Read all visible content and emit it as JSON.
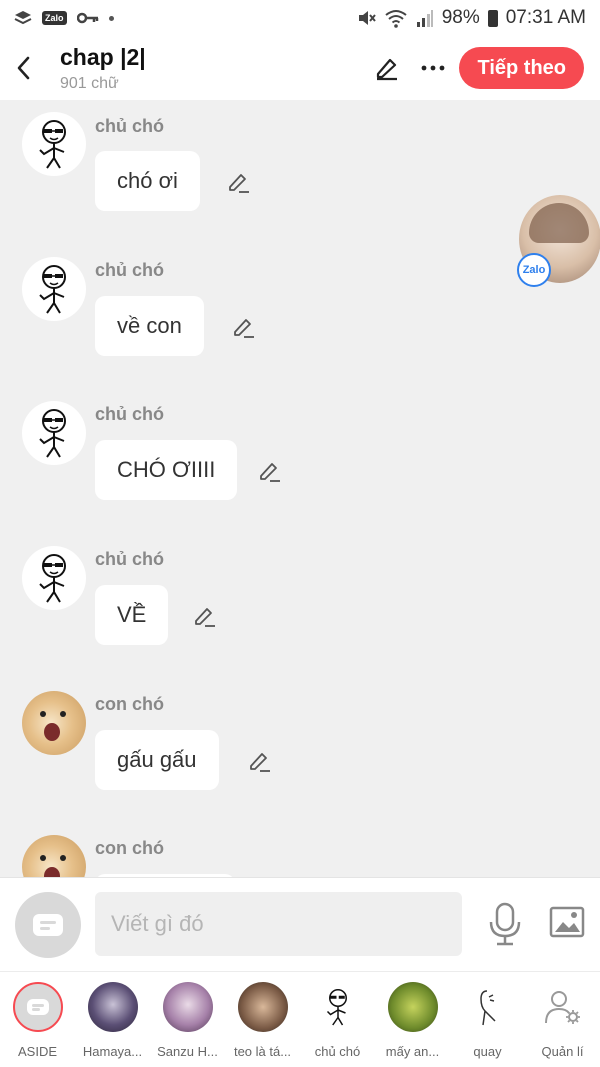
{
  "status_bar": {
    "battery": "98%",
    "time": "07:31 AM",
    "left_icons": [
      "layers-icon",
      "zalo-icon",
      "key-icon",
      "dot-icon"
    ],
    "right_icons": [
      "mute-icon",
      "wifi-icon",
      "signal-icon",
      "battery-icon"
    ],
    "zalo_label": "Zalo"
  },
  "header": {
    "title": "chap |2|",
    "subtitle": "901 chữ",
    "next_label": "Tiếp theo",
    "accent_color": "#f64a51"
  },
  "messages": [
    {
      "author": "chủ chó",
      "text": "chó ơi",
      "avatar": "stickman-glasses"
    },
    {
      "author": "chủ chó",
      "text": "về con",
      "avatar": "stickman-glasses"
    },
    {
      "author": "chủ chó",
      "text": "CHÓ ƠIIII",
      "avatar": "stickman-glasses"
    },
    {
      "author": "chủ chó",
      "text": "VỀ",
      "avatar": "stickman-glasses"
    },
    {
      "author": "con chó",
      "text": "gấu gấu",
      "avatar": "doge"
    },
    {
      "author": "con chó",
      "text": "",
      "avatar": "doge"
    }
  ],
  "floating_bubble": {
    "badge": "Zalo"
  },
  "input": {
    "placeholder": "Viết gì đó"
  },
  "characters": [
    {
      "label": "ASIDE"
    },
    {
      "label": "Hamaya..."
    },
    {
      "label": "Sanzu H..."
    },
    {
      "label": "teo là tá..."
    },
    {
      "label": "chủ chó"
    },
    {
      "label": "mấy an..."
    },
    {
      "label": "quay"
    },
    {
      "label": "Quản lí"
    }
  ]
}
